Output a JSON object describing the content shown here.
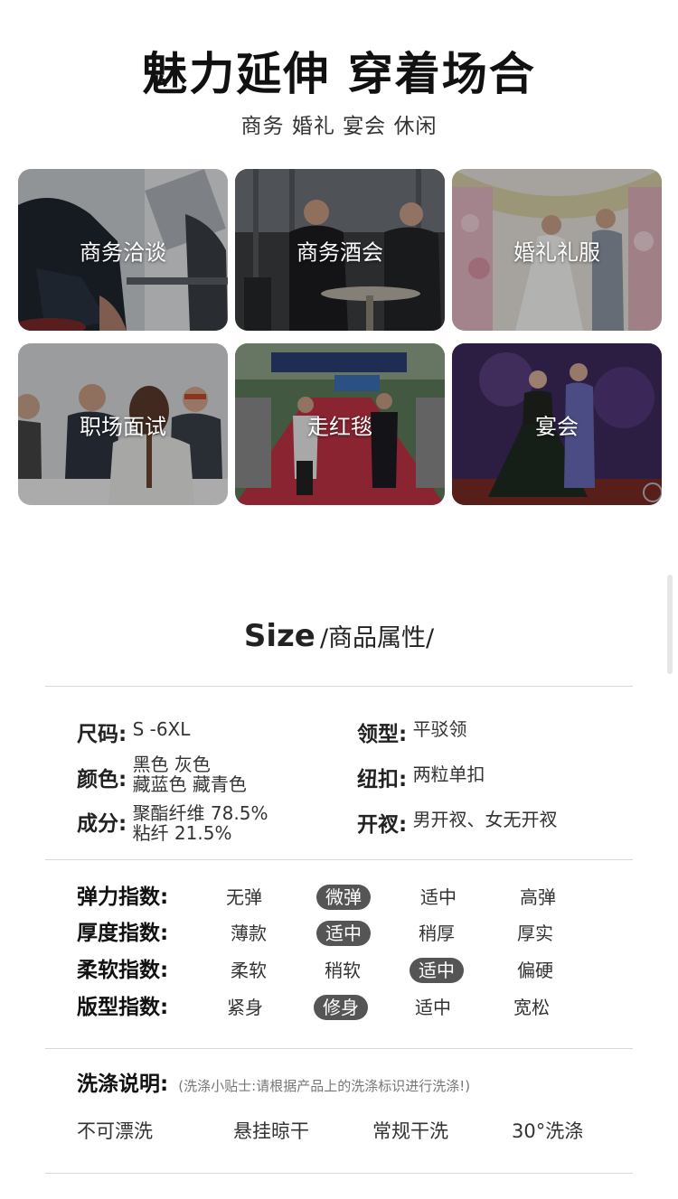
{
  "hero": {
    "title": "魅力延伸 穿着场合",
    "subtitle": "商务 婚礼 宴会 休闲"
  },
  "occasions": [
    {
      "label": "商务洽谈"
    },
    {
      "label": "商务酒会"
    },
    {
      "label": "婚礼礼服"
    },
    {
      "label": "职场面试"
    },
    {
      "label": "走红毯"
    },
    {
      "label": "宴会"
    }
  ],
  "size_section": {
    "title_en": "Size",
    "title_cn": "/商品属性/"
  },
  "attributes": {
    "size": {
      "key": "尺码:",
      "value": "S -6XL"
    },
    "color": {
      "key": "颜色:",
      "line1": "黑色 灰色",
      "line2": "藏蓝色 藏青色"
    },
    "material": {
      "key": "成分:",
      "line1": "聚酯纤维 78.5%",
      "line2": "粘纤 21.5%"
    },
    "collar": {
      "key": "领型:",
      "value": "平驳领"
    },
    "button": {
      "key": "纽扣:",
      "value": "两粒单扣"
    },
    "vent": {
      "key": "开衩:",
      "value": "男开衩、女无开衩"
    }
  },
  "indices": [
    {
      "key": "弹力指数:",
      "options": [
        "无弹",
        "微弹",
        "适中",
        "高弹"
      ],
      "selected": "微弹"
    },
    {
      "key": "厚度指数:",
      "options": [
        "薄款",
        "适中",
        "稍厚",
        "厚实"
      ],
      "selected": "适中"
    },
    {
      "key": "柔软指数:",
      "options": [
        "柔软",
        "稍软",
        "适中",
        "偏硬"
      ],
      "selected": "适中"
    },
    {
      "key": "版型指数:",
      "options": [
        "紧身",
        "修身",
        "适中",
        "宽松"
      ],
      "selected": "修身"
    }
  ],
  "washing": {
    "title": "洗涤说明:",
    "tip": "(洗涤小贴士:请根据产品上的洗涤标识进行洗涤!)",
    "items": [
      "不可漂洗",
      "悬挂晾干",
      "常规干洗",
      "30°洗涤"
    ]
  },
  "colors": {
    "selected_pill": "#555555",
    "rule": "#d8d8d8"
  }
}
